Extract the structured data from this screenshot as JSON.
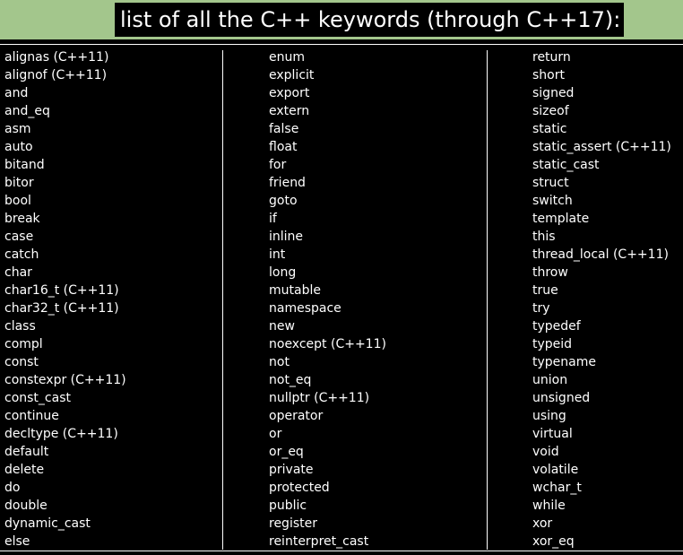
{
  "title": "list of all the C++ keywords (through C++17):",
  "columns": [
    [
      "alignas (C++11)",
      "alignof (C++11)",
      "and",
      "and_eq",
      "asm",
      "auto",
      "bitand",
      "bitor",
      "bool",
      "break",
      "case",
      "catch",
      "char",
      "char16_t (C++11)",
      "char32_t (C++11)",
      "class",
      "compl",
      "const",
      "constexpr (C++11)",
      "const_cast",
      "continue",
      "decltype (C++11)",
      "default",
      "delete",
      "do",
      "double",
      "dynamic_cast",
      "else"
    ],
    [
      "enum",
      "explicit",
      "export",
      "extern",
      "false",
      "float",
      "for",
      "friend",
      "goto",
      "if",
      "inline",
      "int",
      "long",
      "mutable",
      "namespace",
      "new",
      "noexcept (C++11)",
      "not",
      "not_eq",
      "nullptr (C++11)",
      "operator",
      "or",
      "or_eq",
      "private",
      "protected",
      "public",
      "register",
      "reinterpret_cast"
    ],
    [
      "return",
      "short",
      "signed",
      "sizeof",
      "static",
      "static_assert (C++11)",
      "static_cast",
      "struct",
      "switch",
      "template",
      "this",
      "thread_local (C++11)",
      "throw",
      "true",
      "try",
      "typedef",
      "typeid",
      "typename",
      "union",
      "unsigned",
      "using",
      "virtual",
      "void",
      "volatile",
      "wchar_t",
      "while",
      "xor",
      "xor_eq"
    ]
  ],
  "colors": {
    "header_bg": "#a3c68c",
    "panel_bg": "#000000",
    "text": "#ffffff"
  }
}
